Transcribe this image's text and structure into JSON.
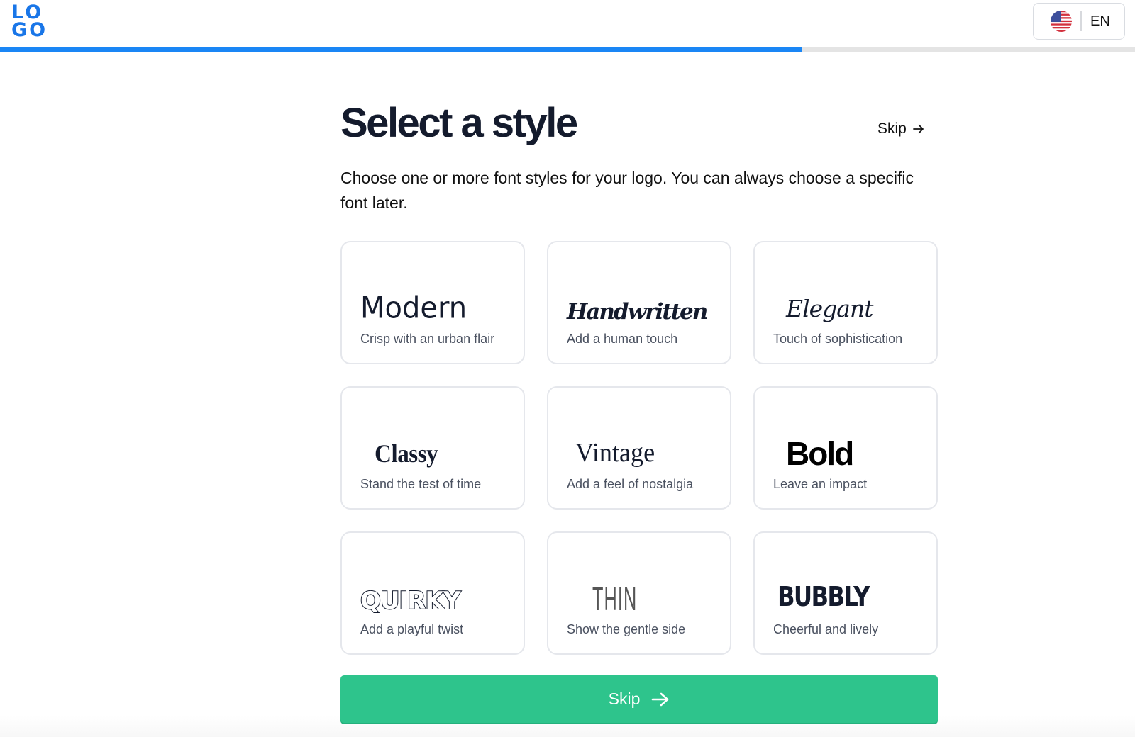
{
  "header": {
    "logo_lines": [
      "LO",
      "GO"
    ],
    "language": {
      "icon": "us-flag-icon",
      "label": "EN"
    },
    "progress_percent": 70.6
  },
  "page": {
    "title": "Select a style",
    "skip_link": "Skip",
    "skip_link_icon": "arrow-right-icon",
    "description": "Choose one or more font styles for your logo. You can always choose a specific font later."
  },
  "styles": [
    {
      "name": "Modern",
      "description": "Crisp with an urban flair"
    },
    {
      "name": "Handwritten",
      "description": "Add a human touch"
    },
    {
      "name": "Elegant",
      "description": "Touch of sophistication"
    },
    {
      "name": "Classy",
      "description": "Stand the test of time"
    },
    {
      "name": "Vintage",
      "description": "Add a feel of nostalgia"
    },
    {
      "name": "Bold",
      "description": "Leave an impact"
    },
    {
      "name": "QUIRKY",
      "description": "Add a playful twist"
    },
    {
      "name": "THIN",
      "description": "Show the gentle side"
    },
    {
      "name": "BUBBLY",
      "description": "Cheerful and lively"
    }
  ],
  "footer": {
    "skip_button": "Skip",
    "skip_button_icon": "arrow-right-icon"
  },
  "colors": {
    "brand_blue": "#1976e8",
    "progress_blue": "#1a86f5",
    "primary_green": "#2ec48c",
    "heading_text": "#141b2d"
  }
}
